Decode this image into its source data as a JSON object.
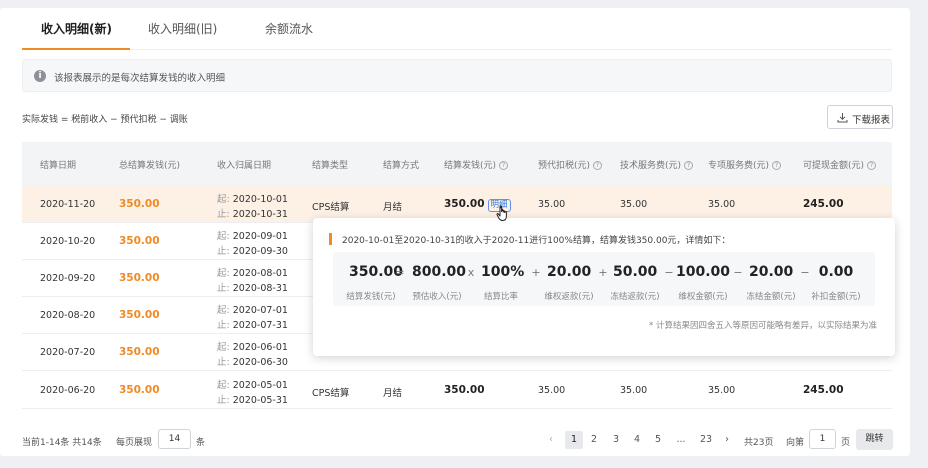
{
  "tabs": [
    {
      "label": "收入明细(新)",
      "active": true
    },
    {
      "label": "收入明细(旧)",
      "active": false
    },
    {
      "label": "余额流水",
      "active": false
    }
  ],
  "notice": {
    "icon": "info-icon",
    "text": "该报表展示的是每次结算发钱的收入明细"
  },
  "formula": "实际发钱 = 税前收入 − 预代扣税 − 调账",
  "download_label": "下载报表",
  "columns": [
    "结算日期",
    "总结算发钱(元)",
    "收入归属日期",
    "结算类型",
    "结算方式",
    "结算发钱(元)",
    "预代扣税(元)",
    "技术服务费(元)",
    "专项服务费(元)",
    "可提现金额(元)"
  ],
  "period_prefix": {
    "start": "起:",
    "end": "止:"
  },
  "detail_link": "明细",
  "rows": [
    {
      "date": "2020-11-20",
      "total": "350.00",
      "start": "2020-10-01",
      "end": "2020-10-31",
      "type": "CPS结算",
      "method": "月结",
      "settle": "350.00",
      "tax": "35.00",
      "tech": "35.00",
      "special": "35.00",
      "withdraw": "245.00"
    },
    {
      "date": "2020-10-20",
      "total": "350.00",
      "start": "2020-09-01",
      "end": "2020-09-30"
    },
    {
      "date": "2020-09-20",
      "total": "350.00",
      "start": "2020-08-01",
      "end": "2020-08-31"
    },
    {
      "date": "2020-08-20",
      "total": "350.00",
      "start": "2020-07-01",
      "end": "2020-07-31"
    },
    {
      "date": "2020-07-20",
      "total": "350.00",
      "start": "2020-06-01",
      "end": "2020-06-30"
    },
    {
      "date": "2020-06-20",
      "total": "350.00",
      "start": "2020-05-01",
      "end": "2020-05-31",
      "type": "CPS结算",
      "method": "月结",
      "settle": "350.00",
      "tax": "35.00",
      "tech": "35.00",
      "special": "35.00",
      "withdraw": "245.00"
    }
  ],
  "popup": {
    "description": "2020-10-01至2020-10-31的收入于2020-11进行100%结算，结算发钱350.00元，详情如下：",
    "terms": [
      {
        "value": "350.00",
        "label": "结算发钱(元)"
      },
      {
        "value": "800.00",
        "label": "预估收入(元)"
      },
      {
        "value": "100%",
        "label": "结算比率"
      },
      {
        "value": "20.00",
        "label": "维权返款(元)"
      },
      {
        "value": "50.00",
        "label": "冻结返款(元)"
      },
      {
        "value": "100.00",
        "label": "维权金额(元)"
      },
      {
        "value": "20.00",
        "label": "冻结金额(元)"
      },
      {
        "value": "0.00",
        "label": "补扣金额(元)"
      }
    ],
    "operators": [
      "=",
      "x",
      "+",
      "+",
      "−",
      "−",
      "−"
    ],
    "note": "* 计算结果因四舍五入等原因可能略有差异，以实际结果为准"
  },
  "pagination": {
    "summary": "当前1-14条 共14条",
    "per_page_label": "每页展现",
    "per_page": "14",
    "per_page_unit": "条",
    "pages": [
      "1",
      "2",
      "3",
      "4",
      "5",
      "...",
      "23"
    ],
    "current": "1",
    "total_pages": "共23页",
    "goto_label": "向第",
    "goto_value": "1",
    "goto_unit": "页",
    "jump_label": "跳转"
  }
}
